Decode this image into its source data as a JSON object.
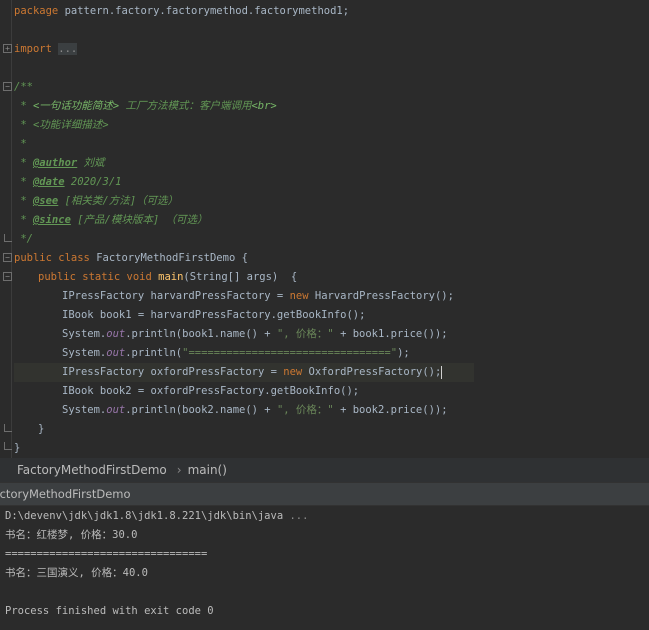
{
  "code": {
    "package_kw": "package",
    "package_name": " pattern.factory.factorymethod.factorymethod1;",
    "import_kw": "import",
    "import_folded": "...",
    "doc_open": "/**",
    "doc_l1_a": " * ",
    "doc_l1_html1": "<一句话功能简述>",
    "doc_l1_b": " 工厂方法模式：客户端调用",
    "doc_l1_html2": "<br>",
    "doc_l2": " * <功能详细描述>",
    "doc_l3": " *",
    "doc_star": " * ",
    "tag_author": "@author",
    "val_author": " 刘斌",
    "tag_date": "@date",
    "val_date": " 2020/3/1",
    "tag_see": "@see",
    "val_see": " [相关类/方法]（可选）",
    "tag_since": "@since",
    "val_since": " [产品/模块版本] （可选）",
    "doc_close": " */",
    "cls_public": "public",
    "cls_class": " class",
    "cls_name": " FactoryMethodFirstDemo {",
    "m_public": "public",
    "m_static": " static",
    "m_void": " void",
    "m_name": " main",
    "m_params": "(String[] args)  {",
    "l1_a": "IPressFactory harvardPressFactory = ",
    "l1_new": "new",
    "l1_b": " HarvardPressFactory();",
    "l2": "IBook book1 = harvardPressFactory.getBookInfo();",
    "l3_a": "System.",
    "l3_out": "out",
    "l3_b": ".println(book1.name() + ",
    "l3_str": "\", 价格：\"",
    "l3_c": " + book1.price());",
    "l4_a": "System.",
    "l4_out": "out",
    "l4_b": ".println(",
    "l4_str": "\"================================\"",
    "l4_c": ");",
    "l5_a": "IPressFactory oxfordPressFactory = ",
    "l5_new": "new",
    "l5_b": " OxfordPressFactory();",
    "l6": "IBook book2 = oxfordPressFactory.getBookInfo();",
    "l7_a": "System.",
    "l7_out": "out",
    "l7_b": ".println(book2.name() + ",
    "l7_str": "\", 价格：\"",
    "l7_c": " + book2.price());",
    "close_method": "}",
    "close_class": "}"
  },
  "breadcrumb": {
    "class_name": "FactoryMethodFirstDemo",
    "separator": "›",
    "method_name": "main()"
  },
  "run_panel": {
    "tab_label": "FactoryMethodFirstDemo"
  },
  "console": {
    "command": "D:\\devenv\\jdk\\jdk1.8\\jdk1.8.221\\jdk\\bin\\java",
    "command_more": " ...",
    "line1": "书名：红楼梦, 价格：30.0",
    "separator": "================================",
    "line2": "书名：三国演义, 价格：40.0",
    "exit": "Process finished with exit code 0"
  },
  "colors": {
    "editor_bg": "#2b2b2b",
    "keyword": "#cc7832",
    "comment": "#629755",
    "method": "#ffc66d",
    "string": "#6a8759",
    "static_field": "#9876aa",
    "text": "#a9b7c6"
  }
}
